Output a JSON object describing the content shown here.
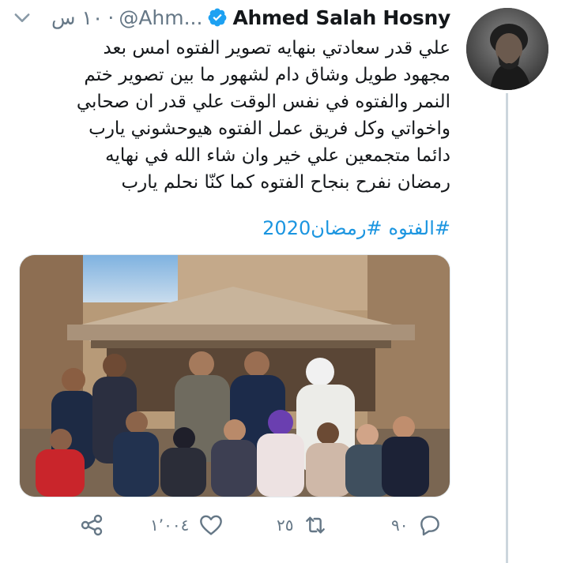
{
  "tweet": {
    "author_name": "Ahmed Salah Hosny",
    "handle": "@Ahm...",
    "separator": "·",
    "time": "١٠ س",
    "lines": [
      "علي قدر سعادتي بنهايه تصوير الفتوه امس  بعد",
      "مجهود طويل وشاق دام لشهور ما بين تصوير ختم",
      "النمر والفتوه في نفس الوقت علي قدر ان صحابي",
      "واخواتي وكل فريق عمل الفتوه هيوحشوني يارب",
      "دائما متجمعين علي خير وان شاء الله في نهايه",
      "رمضان نفرح بنجاح الفتوه كما كنّا نحلم يارب"
    ],
    "hashtags": [
      "#الفتوه",
      "#رمضان2020"
    ]
  },
  "actions": {
    "reply_count": "٩٠",
    "retweet_count": "٢٥",
    "like_count": "١٬٠٠٤"
  },
  "icons": {
    "chevron": "chevron-down-icon",
    "verified": "verified-badge-icon",
    "reply": "reply-icon",
    "retweet": "retweet-icon",
    "like": "heart-icon",
    "share": "share-icon"
  },
  "colors": {
    "link": "#1b95e0",
    "muted": "#657786",
    "verified": "#1da1f2",
    "thread_line": "#ccd6dd"
  }
}
